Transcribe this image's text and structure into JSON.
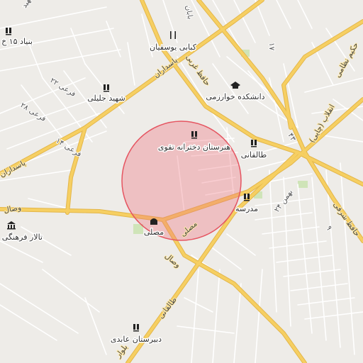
{
  "colors": {
    "background": "#eeece8",
    "minor_road": "#ffffff",
    "major_road": "#f6cf62",
    "major_road_casing": "#e3b64a",
    "green_area": "#cfe4b8",
    "highlight_fill": "#ef6f7a",
    "highlight_stroke": "#e55561",
    "poi_icon": "#222222"
  },
  "highlight": {
    "shape": "circle",
    "fill_opacity": 0.35
  },
  "pois": [
    {
      "name": "بنیاد ۱۵ خ",
      "icon": "school-icon"
    },
    {
      "name": "کبابی یوسفیان",
      "icon": "restaurant-icon"
    },
    {
      "name": "شهید جلیلی",
      "icon": "school-icon"
    },
    {
      "name": "دانشکده خوارزمی",
      "icon": "university-icon"
    },
    {
      "name": "هنرستان دخترانه تقوی",
      "icon": "school-icon"
    },
    {
      "name": "طالقانی",
      "icon": "school-icon"
    },
    {
      "name": "مدرسه",
      "icon": "school-icon"
    },
    {
      "name": "مصلی",
      "icon": "mosque-icon"
    },
    {
      "name": "تالار فرهنگی م",
      "icon": "museum-icon"
    },
    {
      "name": "دبیرستان عابدی",
      "icon": "school-icon"
    }
  ],
  "roads": [
    {
      "name": "پاسداران"
    },
    {
      "name": "حافظ غربی"
    },
    {
      "name": "فرعی ۲۲"
    },
    {
      "name": "فرعی ۲۸"
    },
    {
      "name": "فرعی ۱۴"
    },
    {
      "name": "پاسداران"
    },
    {
      "name": "وصال"
    },
    {
      "name": "مصلی"
    },
    {
      "name": "وصال"
    },
    {
      "name": "طالقانی"
    },
    {
      "name": "بلوار"
    },
    {
      "name": "۲۴ بهمن"
    },
    {
      "name": "انقلاب (چایی)"
    },
    {
      "name": "حکیم نظامی"
    },
    {
      "name": "حافظ شرقی"
    },
    {
      "name": "۱۷"
    },
    {
      "name": "۴۳"
    },
    {
      "name": "شهید"
    },
    {
      "name": "۹"
    },
    {
      "name": "بابان"
    }
  ]
}
